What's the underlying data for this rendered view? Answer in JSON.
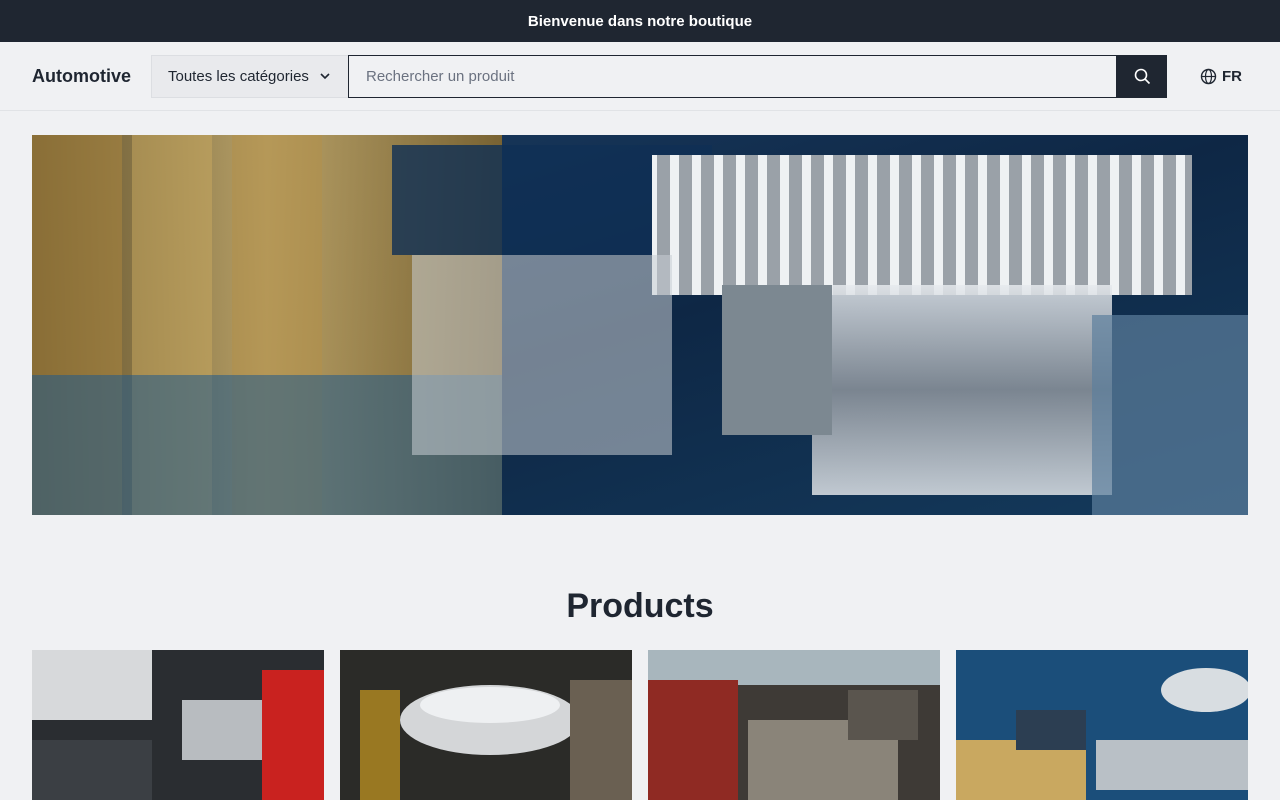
{
  "announcement": "Bienvenue dans notre boutique",
  "header": {
    "logo": "Automotive",
    "category_label": "Toutes les catégories",
    "search_placeholder": "Rechercher un produit",
    "lang": "FR"
  },
  "hero": {
    "image": "engine-bay-chrome-photo"
  },
  "products": {
    "title": "Products",
    "items": [
      {
        "image": "audi-engine-photo"
      },
      {
        "image": "chrome-air-filter-engine-photo"
      },
      {
        "image": "red-car-engine-photo"
      },
      {
        "image": "blue-engine-photo"
      }
    ]
  },
  "colors": {
    "dark": "#1f2631",
    "background": "#f0f1f3"
  }
}
